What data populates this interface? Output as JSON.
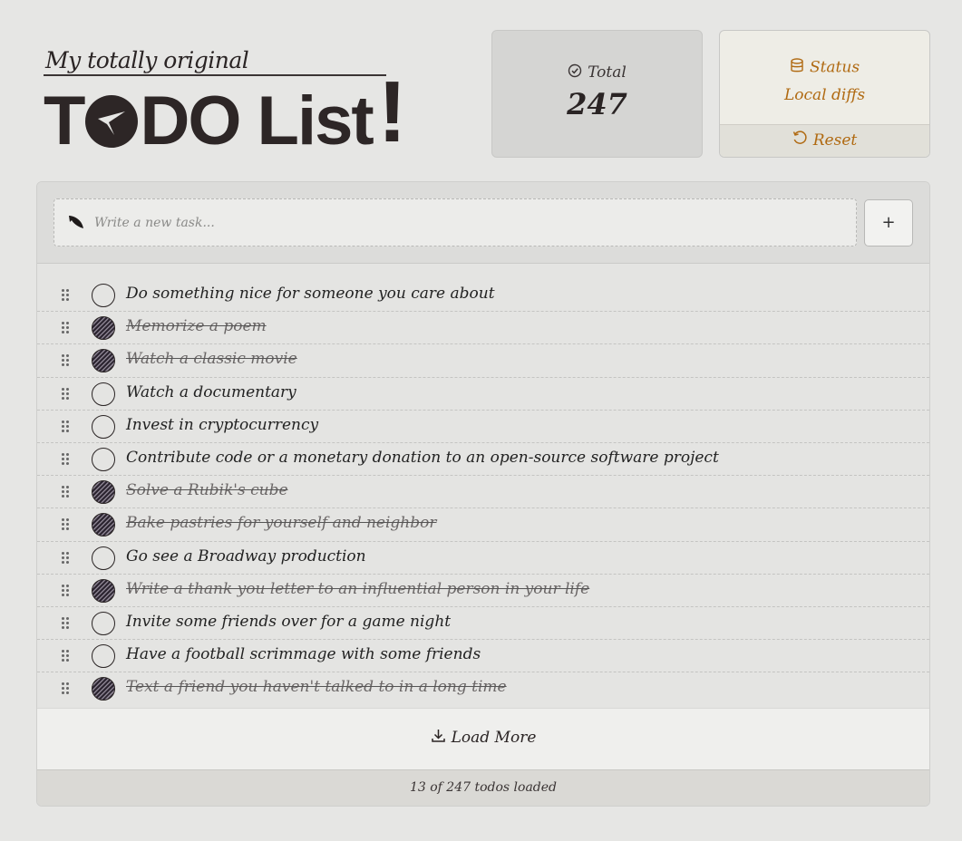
{
  "header": {
    "subtitle": "My totally original",
    "title_part1": "T",
    "title_part2": "DO List",
    "title_bang": "!"
  },
  "stats": {
    "total_label": "Total",
    "total_value": "247",
    "status_label": "Status",
    "status_value": "Local diffs",
    "reset_label": "Reset"
  },
  "composer": {
    "placeholder": "Write a new task...",
    "add_label": "+"
  },
  "todos": [
    {
      "text": "Do something nice for someone you care about",
      "done": false
    },
    {
      "text": "Memorize a poem",
      "done": true
    },
    {
      "text": "Watch a classic movie",
      "done": true
    },
    {
      "text": "Watch a documentary",
      "done": false
    },
    {
      "text": "Invest in cryptocurrency",
      "done": false
    },
    {
      "text": "Contribute code or a monetary donation to an open-source software project",
      "done": false
    },
    {
      "text": "Solve a Rubik's cube",
      "done": true
    },
    {
      "text": "Bake pastries for yourself and neighbor",
      "done": true
    },
    {
      "text": "Go see a Broadway production",
      "done": false
    },
    {
      "text": "Write a thank you letter to an influential person in your life",
      "done": true
    },
    {
      "text": "Invite some friends over for a game night",
      "done": false
    },
    {
      "text": "Have a football scrimmage with some friends",
      "done": false
    },
    {
      "text": "Text a friend you haven't talked to in a long time",
      "done": true
    }
  ],
  "load_more_label": "Load More",
  "footer_text": "13 of 247 todos loaded",
  "colors": {
    "accent": "#b06a12",
    "ink": "#2a2424",
    "background": "#e6e6e4"
  }
}
